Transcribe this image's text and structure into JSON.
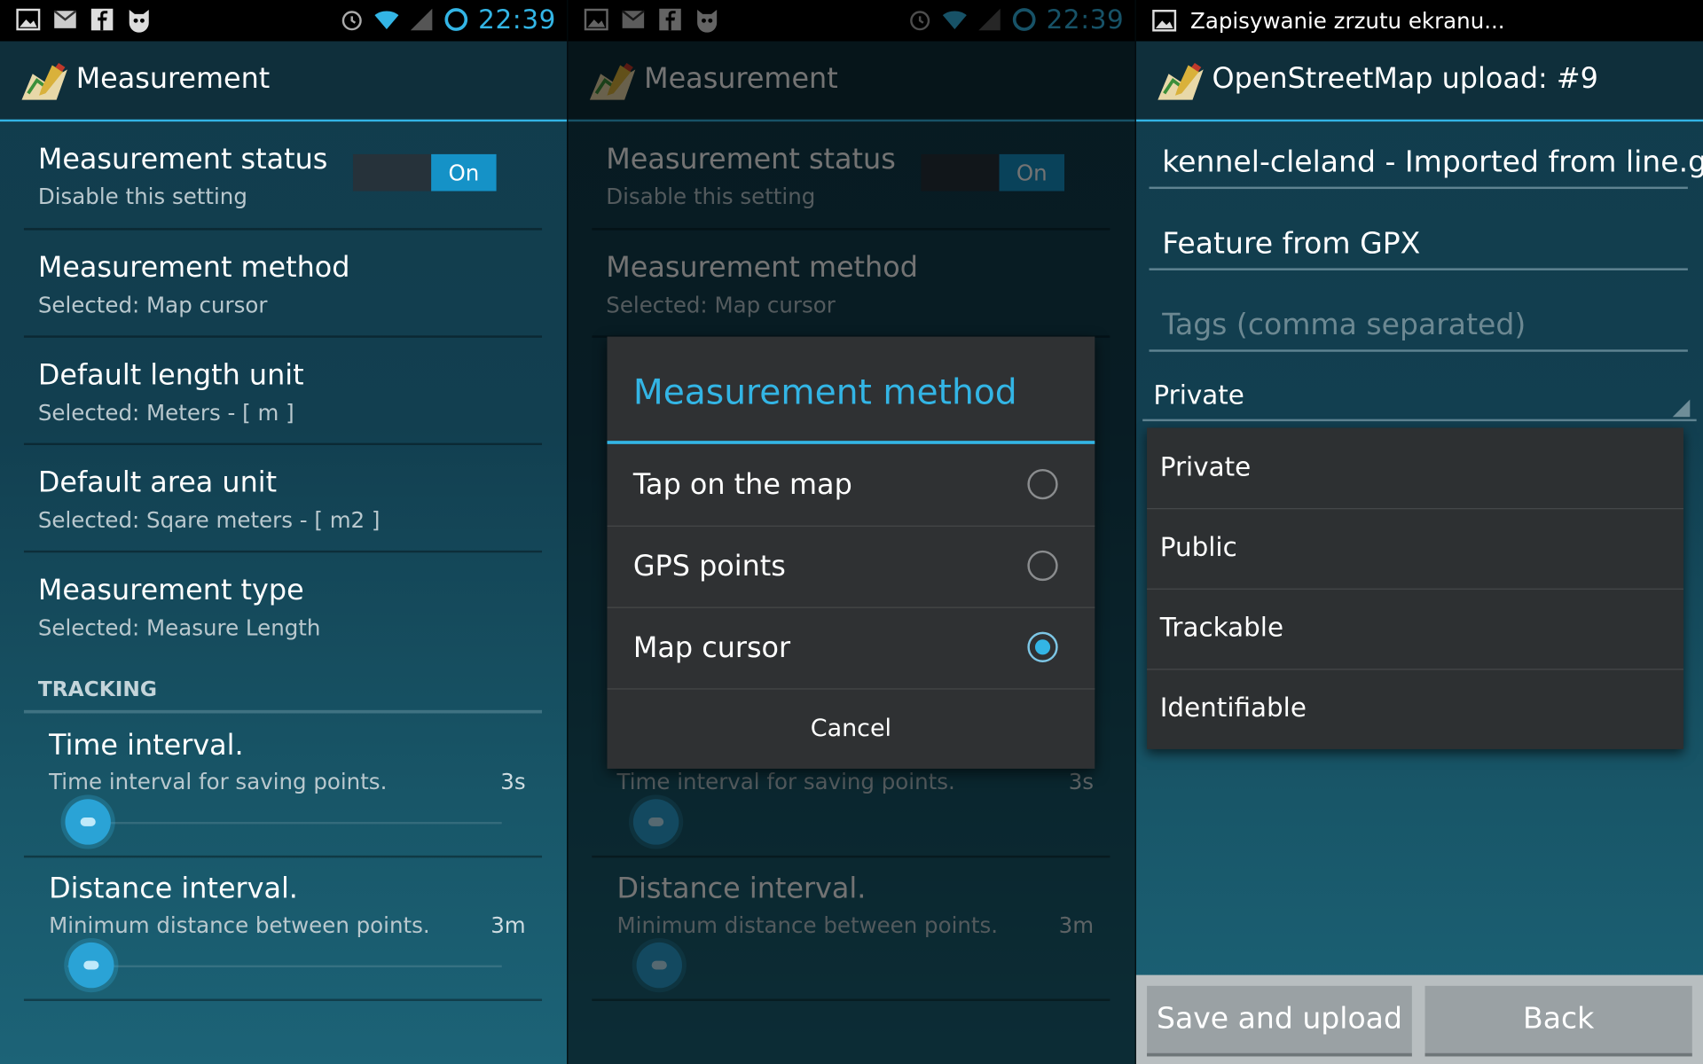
{
  "colors": {
    "accent": "#33b5e5",
    "switch_on": "#1592c7"
  },
  "statusbar": {
    "time": "22:39",
    "notification": "Zapisywanie zrzutu ekranu..."
  },
  "panel1": {
    "title": "Measurement",
    "status": {
      "title": "Measurement status",
      "summary": "Disable this setting",
      "switch_label": "On"
    },
    "method": {
      "title": "Measurement method",
      "summary": "Selected:  Map cursor"
    },
    "length_unit": {
      "title": "Default length unit",
      "summary": "Selected:  Meters - [ m ]"
    },
    "area_unit": {
      "title": "Default area unit",
      "summary": "Selected:  Sqare meters - [ m2 ]"
    },
    "type": {
      "title": "Measurement type",
      "summary": "Selected:  Measure Length"
    },
    "section": "TRACKING",
    "time_interval": {
      "title": "Time interval.",
      "summary": "Time interval for saving points.",
      "value": "3s"
    },
    "distance_interval": {
      "title": "Distance interval.",
      "summary": "Minimum distance between points.",
      "value": "3m"
    }
  },
  "dialog": {
    "title": "Measurement method",
    "options": [
      {
        "label": "Tap on the map",
        "selected": false
      },
      {
        "label": "GPS points",
        "selected": false
      },
      {
        "label": "Map cursor",
        "selected": true
      }
    ],
    "cancel": "Cancel"
  },
  "panel3": {
    "title": "OpenStreetMap upload: #9",
    "name_value": "kennel-cleland - Imported from line.gpx",
    "description_value": "Feature from GPX",
    "tags_placeholder": "Tags (comma separated)",
    "visibility_selected": "Private",
    "visibility_options": [
      "Private",
      "Public",
      "Trackable",
      "Identifiable"
    ],
    "save_button": "Save and upload",
    "back_button": "Back"
  }
}
